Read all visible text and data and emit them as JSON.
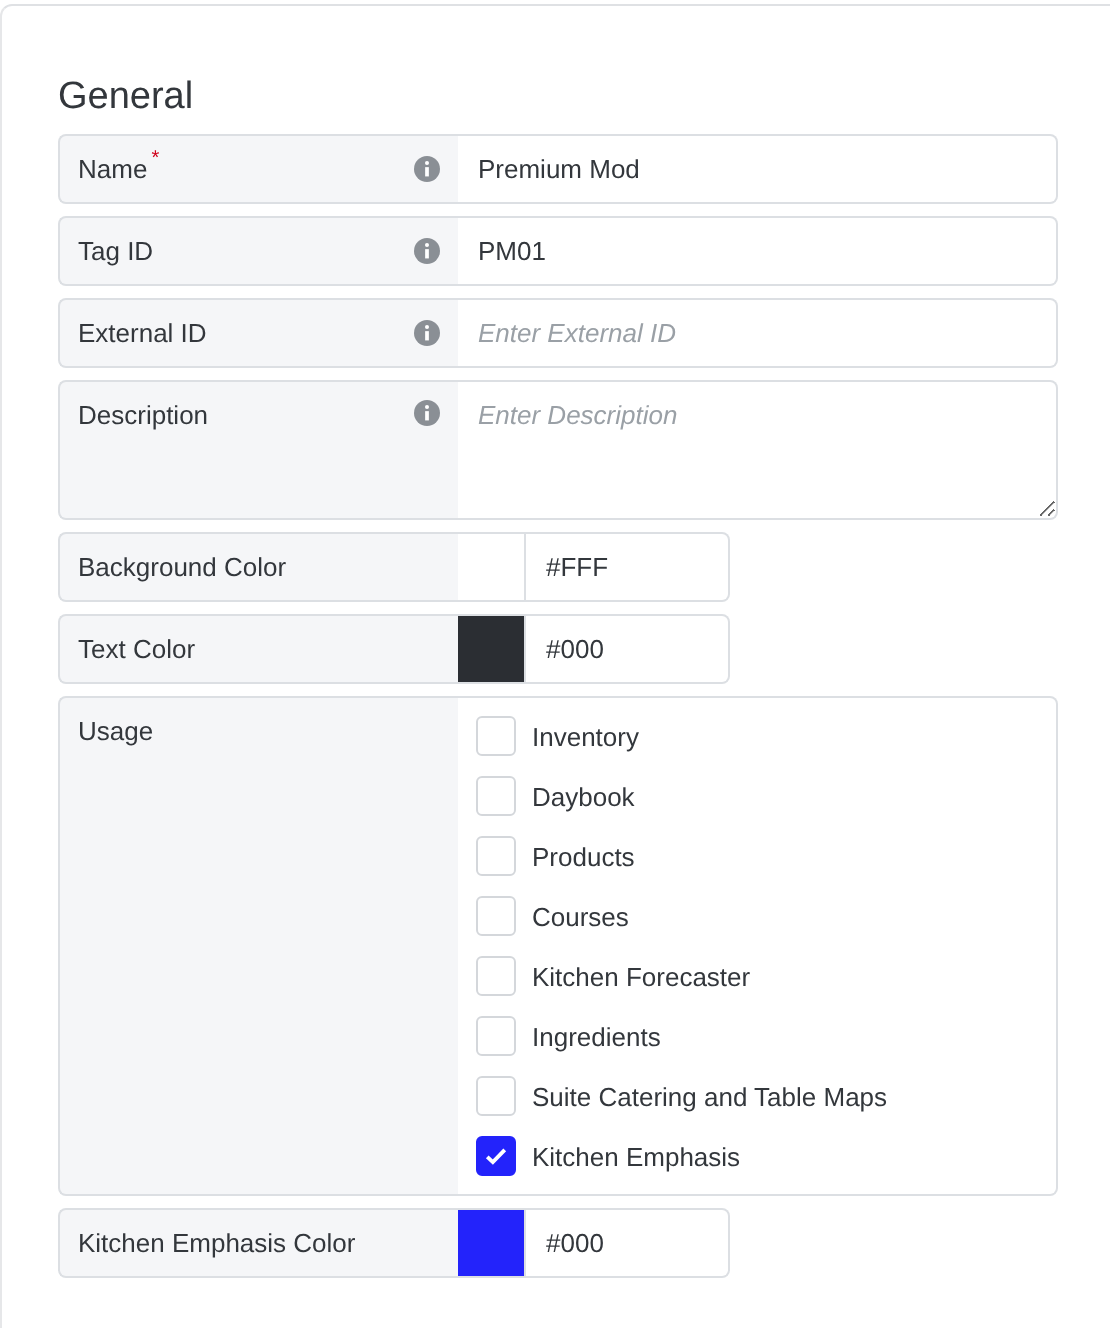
{
  "section": {
    "title": "General"
  },
  "fields": [
    {
      "kind": "text",
      "label": "Name",
      "required_mark": "*",
      "value": "Premium Mod"
    },
    {
      "kind": "text",
      "label": "Tag ID",
      "value": "PM01"
    },
    {
      "kind": "text",
      "label": "External ID",
      "placeholder": "Enter External ID"
    },
    {
      "kind": "textarea",
      "label": "Description",
      "placeholder": "Enter Description"
    }
  ],
  "colors": [
    {
      "label": "Background Color",
      "color": "#ffffff",
      "value": "#FFF"
    },
    {
      "label": "Text Color",
      "color": "#2b2e33",
      "value": "#000"
    }
  ],
  "usage": {
    "label": "Usage",
    "options": [
      {
        "label": "Inventory",
        "checked": false
      },
      {
        "label": "Daybook",
        "checked": false
      },
      {
        "label": "Products",
        "checked": false
      },
      {
        "label": "Courses",
        "checked": false
      },
      {
        "label": "Kitchen Forecaster",
        "checked": false
      },
      {
        "label": "Ingredients",
        "checked": false
      },
      {
        "label": "Suite Catering and Table Maps",
        "checked": false
      },
      {
        "label": "Kitchen Emphasis",
        "checked": true
      }
    ]
  },
  "emphasis_color": {
    "label": "Kitchen Emphasis Color",
    "color": "#2323fb",
    "value": "#000"
  }
}
